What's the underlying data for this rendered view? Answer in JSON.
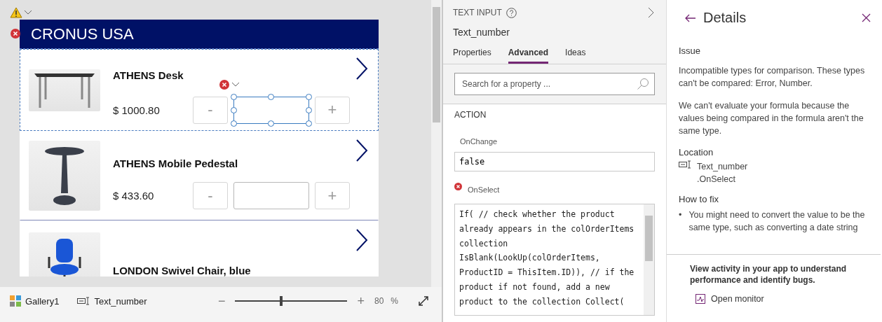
{
  "canvas": {
    "app_title": "CRONUS USA",
    "header_error": true,
    "rows": [
      {
        "name": "ATHENS Desk",
        "price": "$ 1000.80",
        "selected": true,
        "stepper": {
          "minus": "-",
          "plus": "+"
        },
        "kind": "desk"
      },
      {
        "name": "ATHENS Mobile Pedestal",
        "price": "$ 433.60",
        "selected": false,
        "stepper": {
          "minus": "-",
          "plus": "+"
        },
        "kind": "pedestal"
      },
      {
        "name": "LONDON Swivel Chair, blue",
        "selected": false,
        "kind": "chair"
      }
    ]
  },
  "status_bar": {
    "breadcrumbs": [
      {
        "label": "Gallery1",
        "kind": "gallery"
      },
      {
        "label": "Text_number",
        "kind": "textinput"
      }
    ],
    "zoom": {
      "minus": "−",
      "plus": "+",
      "level": 0.41,
      "value": "80",
      "unit": "%"
    }
  },
  "properties": {
    "type": "TEXT INPUT",
    "name": "Text_number",
    "tabs": [
      {
        "label": "Properties",
        "selected": false
      },
      {
        "label": "Advanced",
        "selected": true
      },
      {
        "label": "Ideas",
        "selected": false
      }
    ],
    "search": {
      "placeholder": "Search for a property ..."
    },
    "section": "ACTION",
    "items": [
      {
        "label": "OnChange",
        "error": false,
        "kind": "single",
        "value": "false"
      },
      {
        "label": "OnSelect",
        "error": true,
        "kind": "code",
        "lines": [
          "If( // check whether the product",
          "already appears in the colOrderItems",
          "collection",
          "IsBlank(LookUp(colOrderItems,",
          "ProductID = ThisItem.ID)), // if the",
          "product if not found, add a new",
          "product to the collection Collect("
        ]
      }
    ]
  },
  "details": {
    "title": "Details",
    "issue_heading": "Issue",
    "issue": "Incompatible types for comparison. These types can't be compared: Error, Number.",
    "explanation": "We can't evaluate your formula because the values being compared in the formula aren't the same type.",
    "location_heading": "Location",
    "location": {
      "control": "Text_number",
      "property": ".OnSelect"
    },
    "fix_heading": "How to fix",
    "fixes": [
      {
        "bullet": "•",
        "text": "You might need to convert the value to be the same type, such as converting a date string"
      }
    ],
    "footer": "View activity in your app to understand performance and identify bugs.",
    "monitor_link": "Open monitor"
  }
}
